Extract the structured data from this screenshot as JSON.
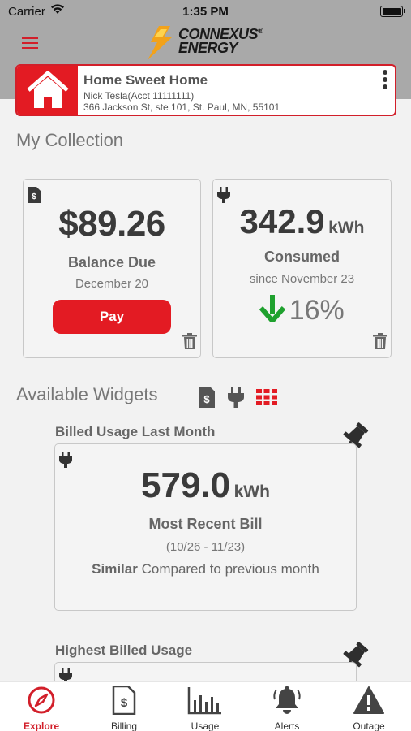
{
  "status_bar": {
    "carrier": "Carrier",
    "time": "1:35 PM"
  },
  "brand": {
    "line1": "CONNEXUS",
    "line2": "ENERGY",
    "reg": "®",
    "accent": "#e31b23"
  },
  "account": {
    "name": "Home Sweet Home",
    "holder": "Nick Tesla(Acct 11111111)",
    "address": "366 Jackson St, ste 101, St. Paul, MN, 55101"
  },
  "collection": {
    "title": "My Collection",
    "balance": {
      "amount": "$89.26",
      "label": "Balance Due",
      "date": "December 20",
      "pay_label": "Pay"
    },
    "consumption": {
      "value": "342.9",
      "unit": "kWh",
      "label": "Consumed",
      "since": "since November 23",
      "change": "16%",
      "change_direction": "down",
      "change_color": "#1fa12e"
    }
  },
  "widgets": {
    "title": "Available Widgets",
    "items": [
      {
        "title": "Billed Usage Last Month",
        "value": "579.0",
        "unit": "kWh",
        "label": "Most Recent Bill",
        "range": "(10/26 - 11/23)",
        "compare_bold": "Similar",
        "compare_text": "Compared to previous month"
      },
      {
        "title": "Highest Billed Usage"
      }
    ]
  },
  "tabs": [
    {
      "label": "Explore",
      "icon": "compass-icon",
      "active": true
    },
    {
      "label": "Billing",
      "icon": "bill-icon",
      "active": false
    },
    {
      "label": "Usage",
      "icon": "bar-chart-icon",
      "active": false
    },
    {
      "label": "Alerts",
      "icon": "bell-icon",
      "active": false
    },
    {
      "label": "Outage",
      "icon": "warning-icon",
      "active": false
    }
  ]
}
